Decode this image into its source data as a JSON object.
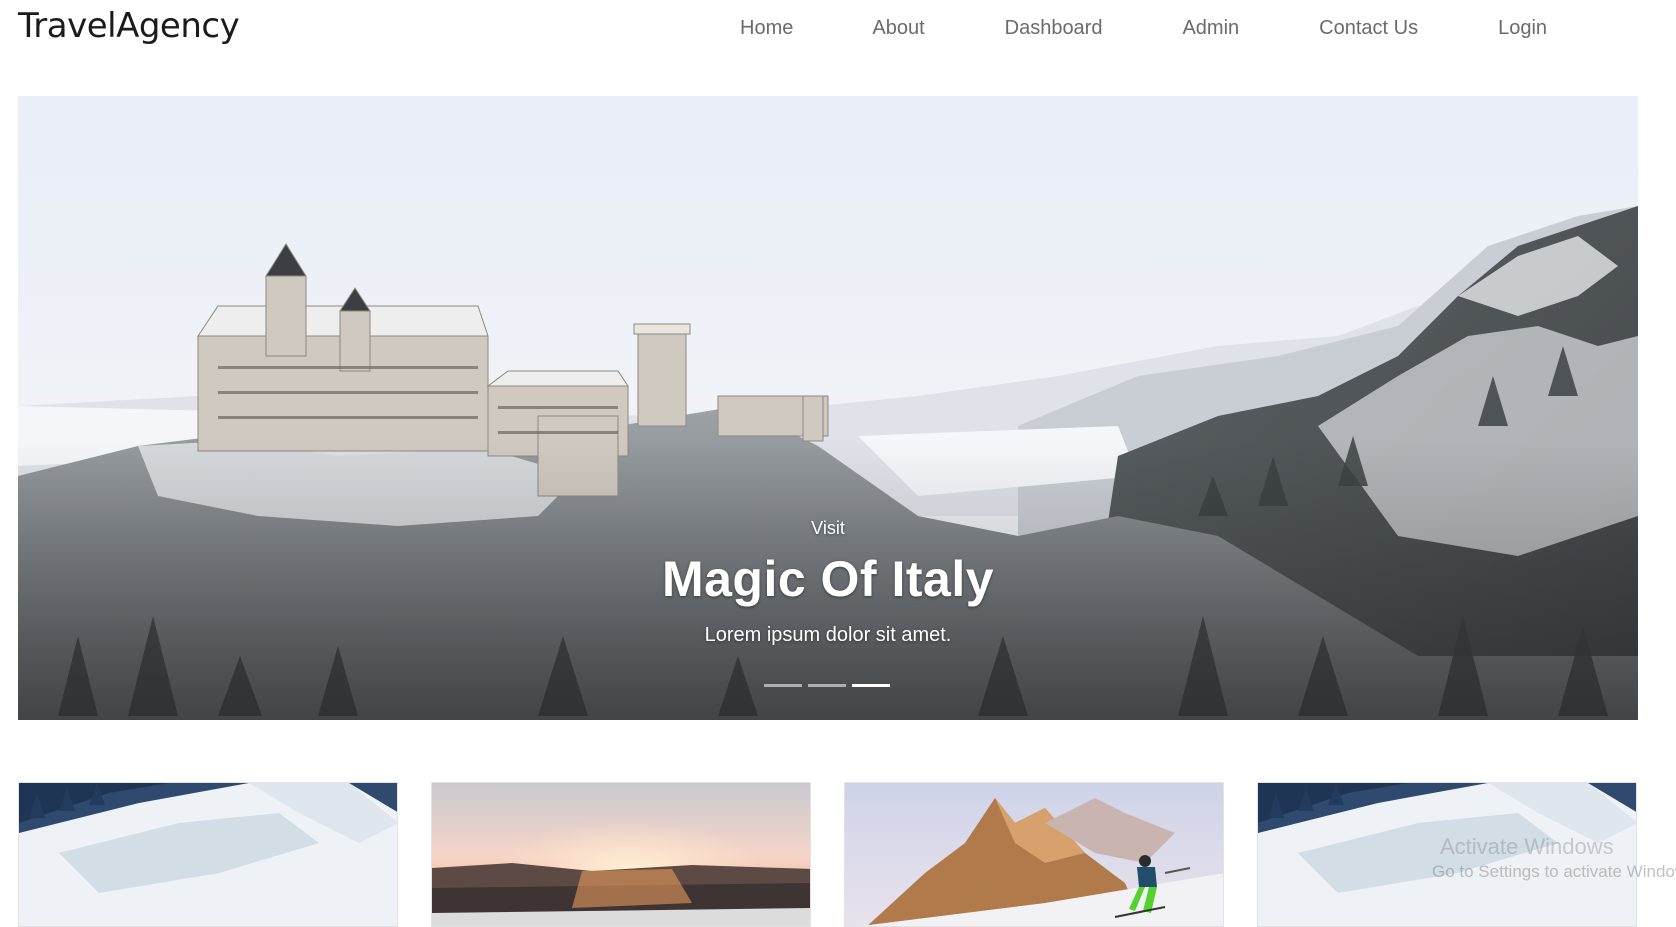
{
  "brand": "TravelAgency",
  "nav": {
    "items": [
      {
        "label": "Home"
      },
      {
        "label": "About"
      },
      {
        "label": "Dashboard"
      },
      {
        "label": "Admin"
      },
      {
        "label": "Contact Us"
      },
      {
        "label": "Login"
      }
    ]
  },
  "hero": {
    "kicker": "Visit",
    "title": "Magic Of Italy",
    "subtitle": "Lorem ipsum dolor sit amet.",
    "slides_count": 3,
    "active_slide": 3
  },
  "cards": [
    {
      "image": "snowy-mountain-slope"
    },
    {
      "image": "sunset-over-snowy-forest"
    },
    {
      "image": "skier-on-rocky-mountain"
    },
    {
      "image": "snowy-mountain-slope"
    }
  ],
  "watermark": {
    "line1": "Activate Windows",
    "line2": "Go to Settings to activate Windows."
  },
  "colors": {
    "nav_text": "#6b6b6b",
    "brand_text": "#1b1b1b",
    "caption_text": "#ffffff"
  }
}
